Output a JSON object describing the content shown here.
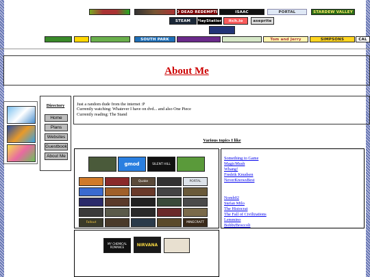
{
  "top_banners": {
    "row1": [
      "",
      "",
      "RED DEAD REDEMPTION",
      "ISAAC",
      "PORTAL",
      "STARDEW VALLEY"
    ],
    "row2": [
      "STEAM",
      "PlayStation",
      "itch.io",
      "aseprite"
    ],
    "row3": [
      "",
      "SOUTH PARK",
      "Tom and Jerry",
      "SIMPSONS",
      "CAL"
    ]
  },
  "header": {
    "title": "About Me"
  },
  "directory": {
    "title": "Directory",
    "items": [
      "Home",
      "Plans",
      "Websites",
      "Guestbook",
      "About Me"
    ]
  },
  "bio": {
    "line1": "Just a random dude from the internet :P",
    "line2": "Currently watching: Whatever I have on dvd... and also One Piece",
    "line3": "Currently reading: The Stand"
  },
  "topics": {
    "heading": "Various topics I like"
  },
  "games": {
    "row1": [
      "",
      "gmod",
      "SILENT HILL",
      ""
    ],
    "row2": [
      "",
      "",
      "Quake",
      "",
      "PORTAL"
    ],
    "row3": [
      "",
      "",
      "",
      "",
      ""
    ],
    "row4": [
      "",
      "",
      "",
      "",
      ""
    ],
    "row5": [
      "",
      "",
      "",
      "",
      ""
    ],
    "row6": [
      "Fallout",
      "",
      "",
      "",
      "MINECRAFT"
    ]
  },
  "links": {
    "group1": [
      "Something to Game",
      "MagicMush",
      "Whang!",
      "Fredrik Knudsen",
      "NeverKnowsBest"
    ],
    "group2": [
      "Nomb02",
      "Stefan Milo",
      "The Histocrat",
      "The Fall of Civilizations",
      "Lemmino",
      "BobbyBroccoli"
    ]
  },
  "music": [
    "MY CHEMICAL ROMANCE",
    "NIRVANA",
    ""
  ],
  "colors": {
    "title_red": "#cc0000",
    "link_blue": "#0000ee"
  }
}
